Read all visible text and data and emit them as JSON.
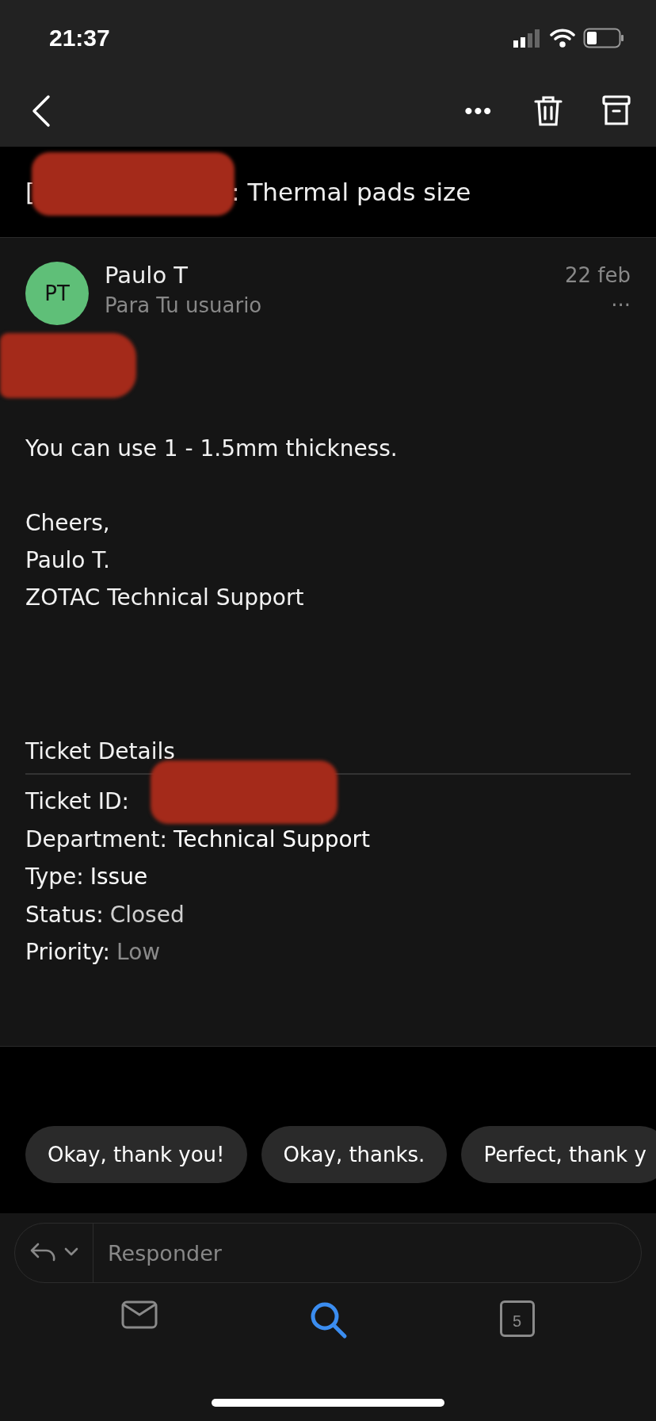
{
  "status_bar": {
    "time": "21:37"
  },
  "toolbar": {
    "more_icon": "•••"
  },
  "subject": {
    "prefix": "[",
    "text": ": Thermal pads size"
  },
  "message": {
    "avatar_initials": "PT",
    "sender": "Paulo T",
    "recipient": "Para Tu usuario",
    "date": "22 feb",
    "more": "···",
    "body": [
      {
        "kind": "paragraph",
        "lines": [
          "You can use 1 - 1.5mm thickness."
        ]
      },
      {
        "kind": "paragraph",
        "lines": [
          "Cheers,",
          "Paulo T.",
          "ZOTAC Technical Support"
        ]
      }
    ],
    "ticket": {
      "title": "Ticket Details",
      "rows": [
        {
          "label": "Ticket ID:",
          "redacted": true
        },
        {
          "label": "Department:",
          "value": "Technical Support",
          "color": "#ffffff"
        },
        {
          "label": "Type:",
          "value": "Issue",
          "color": "#ffffff"
        },
        {
          "label": "Status:",
          "value": "Closed",
          "color": "#cfcfcf"
        },
        {
          "label": "Priority:",
          "value": "Low",
          "color": "#8a8a8a"
        }
      ]
    }
  },
  "quick_replies": [
    "Okay, thank you!",
    "Okay, thanks.",
    "Perfect, thank y"
  ],
  "reply_field": {
    "placeholder": "Responder"
  },
  "tab_bar": [
    {
      "kind": "mail",
      "selected": false
    },
    {
      "kind": "search",
      "selected": true
    },
    {
      "kind": "calendar",
      "badge": "5",
      "selected": false
    }
  ]
}
